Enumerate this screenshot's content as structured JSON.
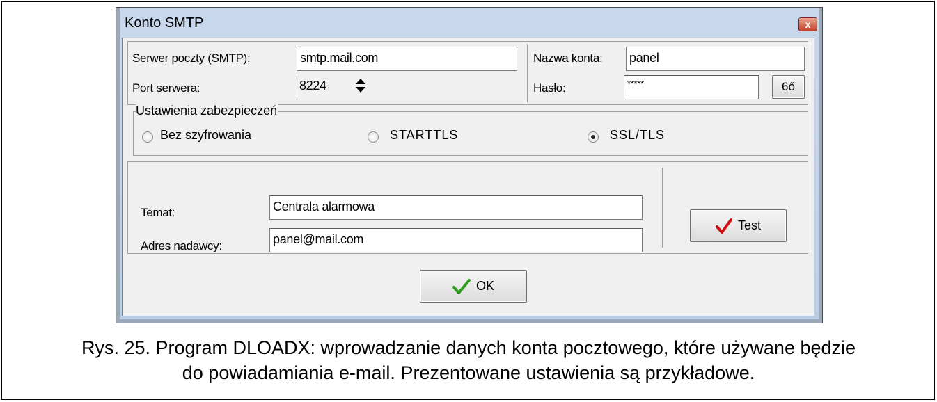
{
  "window": {
    "title": "Konto SMTP",
    "close_glyph": "x"
  },
  "smtp": {
    "server_label": "Serwer poczty (SMTP):",
    "server_value": "smtp.mail.com",
    "port_label": "Port serwera:",
    "port_value": "8224",
    "account_label": "Nazwa konta:",
    "account_value": "panel",
    "password_label": "Hasło:",
    "password_value": "*****",
    "show_password_label": "6ő"
  },
  "security": {
    "group_label": "Ustawienia zabezpieczeń",
    "options": [
      "Bez szyfrowania",
      "STARTTLS",
      "SSL/TLS"
    ],
    "selected": "SSL/TLS"
  },
  "message": {
    "subject_label": "Temat:",
    "subject_value": "Centrala alarmowa",
    "sender_label": "Adres nadawcy:",
    "sender_value": "panel@mail.com",
    "test_label": "Test"
  },
  "footer": {
    "ok_label": "OK"
  },
  "caption": {
    "line1": "Rys. 25. Program DLOADX: wprowadzanie danych konta pocztowego, które używane będzie",
    "line2": "do powiadamiania e-mail. Prezentowane ustawienia są przykładowe."
  }
}
